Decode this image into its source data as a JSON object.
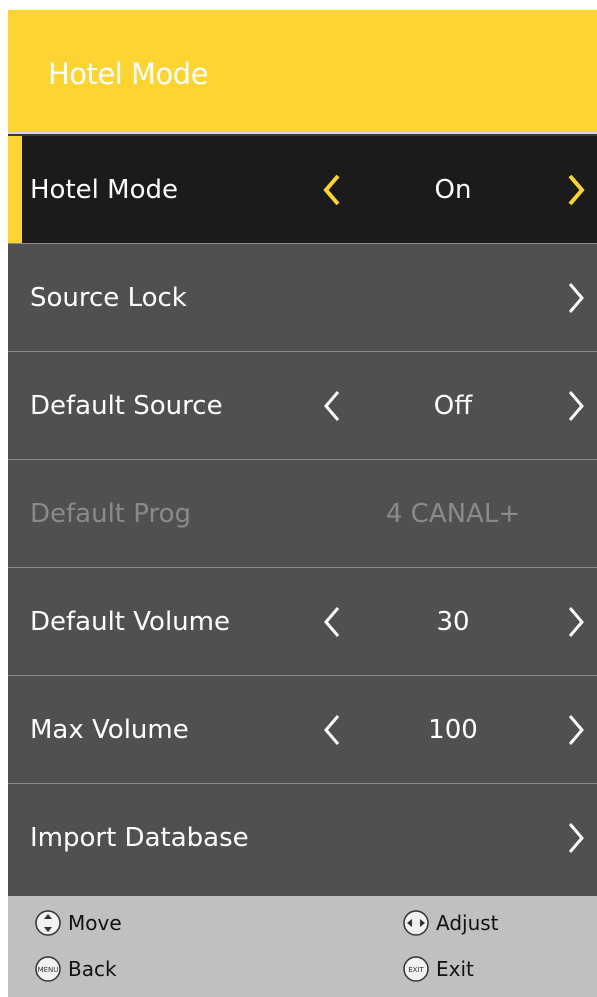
{
  "header": {
    "title": "Hotel Mode"
  },
  "rows": [
    {
      "label": "Hotel Mode",
      "value": "On",
      "arrows": "both",
      "selected": true
    },
    {
      "label": "Source Lock",
      "value": "",
      "arrows": "right"
    },
    {
      "label": "Default Source",
      "value": "Off",
      "arrows": "both"
    },
    {
      "label": "Default Prog",
      "value": "4 CANAL+",
      "arrows": "none",
      "disabled": true
    },
    {
      "label": "Default Volume",
      "value": "30",
      "arrows": "both"
    },
    {
      "label": "Max Volume",
      "value": "100",
      "arrows": "both"
    },
    {
      "label": "Import Database",
      "value": "",
      "arrows": "right"
    }
  ],
  "footer": {
    "move": "Move",
    "adjust": "Adjust",
    "back": "Back",
    "exit": "Exit",
    "menu_key": "MENU",
    "exit_key": "EXIT"
  },
  "colors": {
    "accent": "#fdd432",
    "row_bg": "#505050",
    "selected_bg": "#1b1b1b",
    "footer_bg": "#c0c0c0",
    "disabled_text": "#8a8a8a"
  }
}
